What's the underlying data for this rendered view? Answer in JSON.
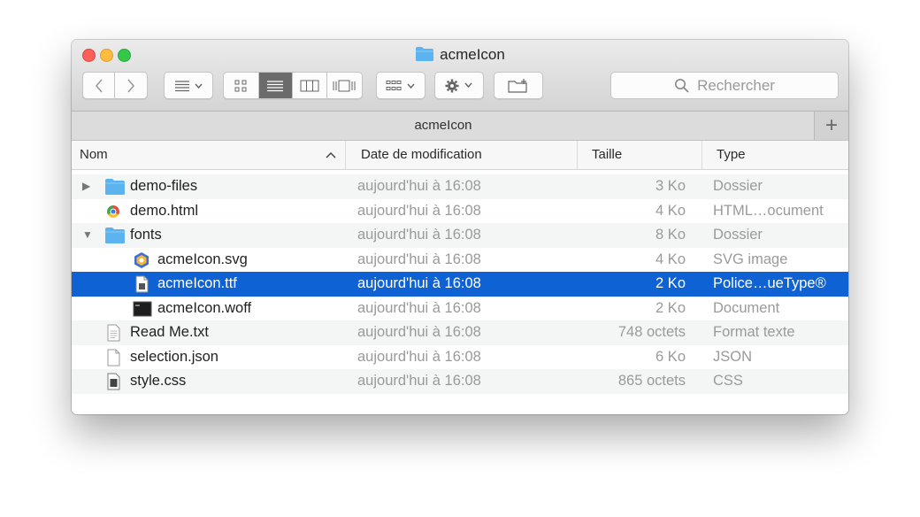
{
  "window": {
    "title": "acmeIcon",
    "path_title": "acmeIcon",
    "plus_label": "+"
  },
  "toolbar": {
    "back_icon": "chevron-left-icon",
    "forward_icon": "chevron-right-icon",
    "search_placeholder": "Rechercher"
  },
  "columns": {
    "name": "Nom",
    "date": "Date de modification",
    "size": "Taille",
    "type": "Type"
  },
  "files": [
    {
      "name": "demo-files",
      "date": "aujourd'hui à 16:08",
      "size": "3 Ko",
      "type": "Dossier",
      "icon": "folder-icon",
      "indent": 0,
      "disclosure": "collapsed"
    },
    {
      "name": "demo.html",
      "date": "aujourd'hui à 16:08",
      "size": "4 Ko",
      "type": "HTML…ocument",
      "icon": "html-file-icon",
      "indent": 0,
      "disclosure": ""
    },
    {
      "name": "fonts",
      "date": "aujourd'hui à 16:08",
      "size": "8 Ko",
      "type": "Dossier",
      "icon": "folder-icon",
      "indent": 0,
      "disclosure": "expanded"
    },
    {
      "name": "acmeIcon.svg",
      "date": "aujourd'hui à 16:08",
      "size": "4 Ko",
      "type": "SVG image",
      "icon": "svg-file-icon",
      "indent": 1,
      "disclosure": ""
    },
    {
      "name": "acmeIcon.ttf",
      "date": "aujourd'hui à 16:08",
      "size": "2 Ko",
      "type": "Police…ueType®",
      "icon": "font-file-icon",
      "indent": 1,
      "disclosure": "",
      "selected": true
    },
    {
      "name": "acmeIcon.woff",
      "date": "aujourd'hui à 16:08",
      "size": "2 Ko",
      "type": "Document",
      "icon": "terminal-file-icon",
      "indent": 1,
      "disclosure": ""
    },
    {
      "name": "Read Me.txt",
      "date": "aujourd'hui à 16:08",
      "size": "748 octets",
      "type": "Format texte",
      "icon": "text-file-icon",
      "indent": 0,
      "disclosure": ""
    },
    {
      "name": "selection.json",
      "date": "aujourd'hui à 16:08",
      "size": "6 Ko",
      "type": "JSON",
      "icon": "blank-file-icon",
      "indent": 0,
      "disclosure": ""
    },
    {
      "name": "style.css",
      "date": "aujourd'hui à 16:08",
      "size": "865 octets",
      "type": "CSS",
      "icon": "css-file-icon",
      "indent": 0,
      "disclosure": ""
    }
  ],
  "colors": {
    "selection": "#0e62d4",
    "folder": "#5bb4f0"
  }
}
